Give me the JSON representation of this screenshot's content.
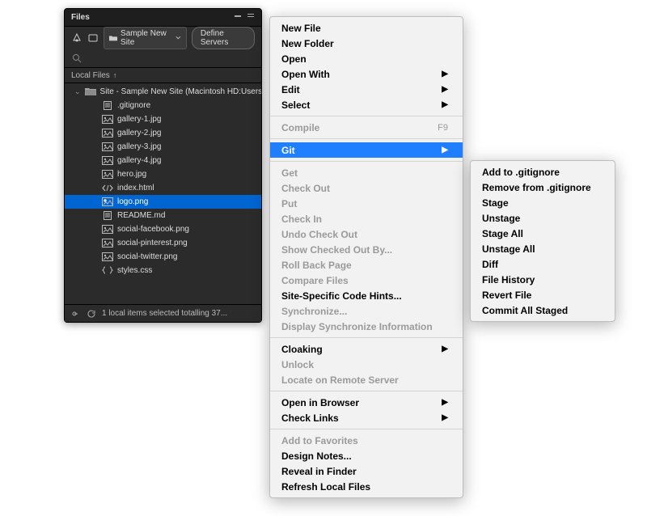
{
  "panel": {
    "title": "Files",
    "site_selector_label": "Sample New Site",
    "define_servers": "Define Servers",
    "local_files_header": "Local Files",
    "root_label": "Site - Sample New Site (Macintosh HD:Users:...",
    "files": [
      {
        "icon": "file",
        "name": ".gitignore",
        "selected": false
      },
      {
        "icon": "image",
        "name": "gallery-1.jpg",
        "selected": false
      },
      {
        "icon": "image",
        "name": "gallery-2.jpg",
        "selected": false
      },
      {
        "icon": "image",
        "name": "gallery-3.jpg",
        "selected": false
      },
      {
        "icon": "image",
        "name": "gallery-4.jpg",
        "selected": false
      },
      {
        "icon": "image",
        "name": "hero.jpg",
        "selected": false
      },
      {
        "icon": "html",
        "name": "index.html",
        "selected": false
      },
      {
        "icon": "image",
        "name": "logo.png",
        "selected": true
      },
      {
        "icon": "file",
        "name": "README.md",
        "selected": false
      },
      {
        "icon": "image",
        "name": "social-facebook.png",
        "selected": false
      },
      {
        "icon": "image",
        "name": "social-pinterest.png",
        "selected": false
      },
      {
        "icon": "image",
        "name": "social-twitter.png",
        "selected": false
      },
      {
        "icon": "css",
        "name": "styles.css",
        "selected": false
      }
    ],
    "status": "1 local items selected totalling 37..."
  },
  "menu": {
    "groups": [
      [
        {
          "label": "New File",
          "enabled": true
        },
        {
          "label": "New Folder",
          "enabled": true
        },
        {
          "label": "Open",
          "enabled": true
        },
        {
          "label": "Open With",
          "enabled": true,
          "submenu": true
        },
        {
          "label": "Edit",
          "enabled": true,
          "submenu": true
        },
        {
          "label": "Select",
          "enabled": true,
          "submenu": true
        }
      ],
      [
        {
          "label": "Compile",
          "enabled": false,
          "shortcut": "F9"
        }
      ],
      [
        {
          "label": "Git",
          "enabled": true,
          "submenu": true,
          "highlight": true
        }
      ],
      [
        {
          "label": "Get",
          "enabled": false
        },
        {
          "label": "Check Out",
          "enabled": false
        },
        {
          "label": "Put",
          "enabled": false
        },
        {
          "label": "Check In",
          "enabled": false
        },
        {
          "label": "Undo Check Out",
          "enabled": false
        },
        {
          "label": "Show Checked Out By...",
          "enabled": false
        },
        {
          "label": "Roll Back Page",
          "enabled": false
        },
        {
          "label": "Compare Files",
          "enabled": false
        },
        {
          "label": "Site-Specific Code Hints...",
          "enabled": true
        },
        {
          "label": "Synchronize...",
          "enabled": false
        },
        {
          "label": "Display Synchronize Information",
          "enabled": false
        }
      ],
      [
        {
          "label": "Cloaking",
          "enabled": true,
          "submenu": true
        },
        {
          "label": "Unlock",
          "enabled": false
        },
        {
          "label": "Locate on Remote Server",
          "enabled": false
        }
      ],
      [
        {
          "label": "Open in Browser",
          "enabled": true,
          "submenu": true
        },
        {
          "label": "Check Links",
          "enabled": true,
          "submenu": true
        }
      ],
      [
        {
          "label": "Add to Favorites",
          "enabled": false
        },
        {
          "label": "Design Notes...",
          "enabled": true
        },
        {
          "label": "Reveal in Finder",
          "enabled": true
        },
        {
          "label": "Refresh Local Files",
          "enabled": true
        }
      ]
    ]
  },
  "git_submenu": {
    "items": [
      "Add to .gitignore",
      "Remove from .gitignore",
      "Stage",
      "Unstage",
      "Stage All",
      "Unstage All",
      "Diff",
      "File History",
      "Revert File",
      "Commit All Staged"
    ]
  }
}
